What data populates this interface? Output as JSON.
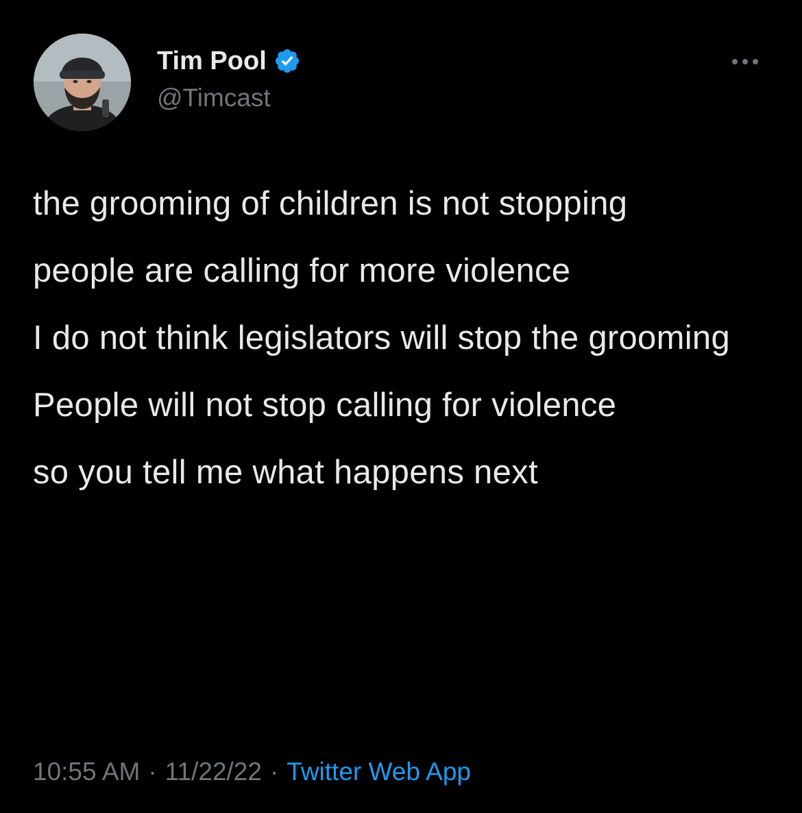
{
  "author": {
    "name": "Tim Pool",
    "handle": "@Timcast",
    "verified_icon": "verified-badge-icon",
    "avatar_icon": "profile-photo"
  },
  "more_icon": "more-horizontal-icon",
  "tweet": {
    "paragraphs": [
      "the grooming of children is not stopping",
      "people are calling for more violence",
      "I do not think legislators will stop the grooming",
      "People will not stop calling for violence",
      "so you tell me what happens next"
    ],
    "time": "10:55 AM",
    "separator": "·",
    "date": "11/22/22",
    "source": "Twitter Web App"
  },
  "colors": {
    "background": "#000000",
    "primary_text": "#e7e9ea",
    "secondary_text": "#71767b",
    "accent": "#1d9bf0"
  }
}
